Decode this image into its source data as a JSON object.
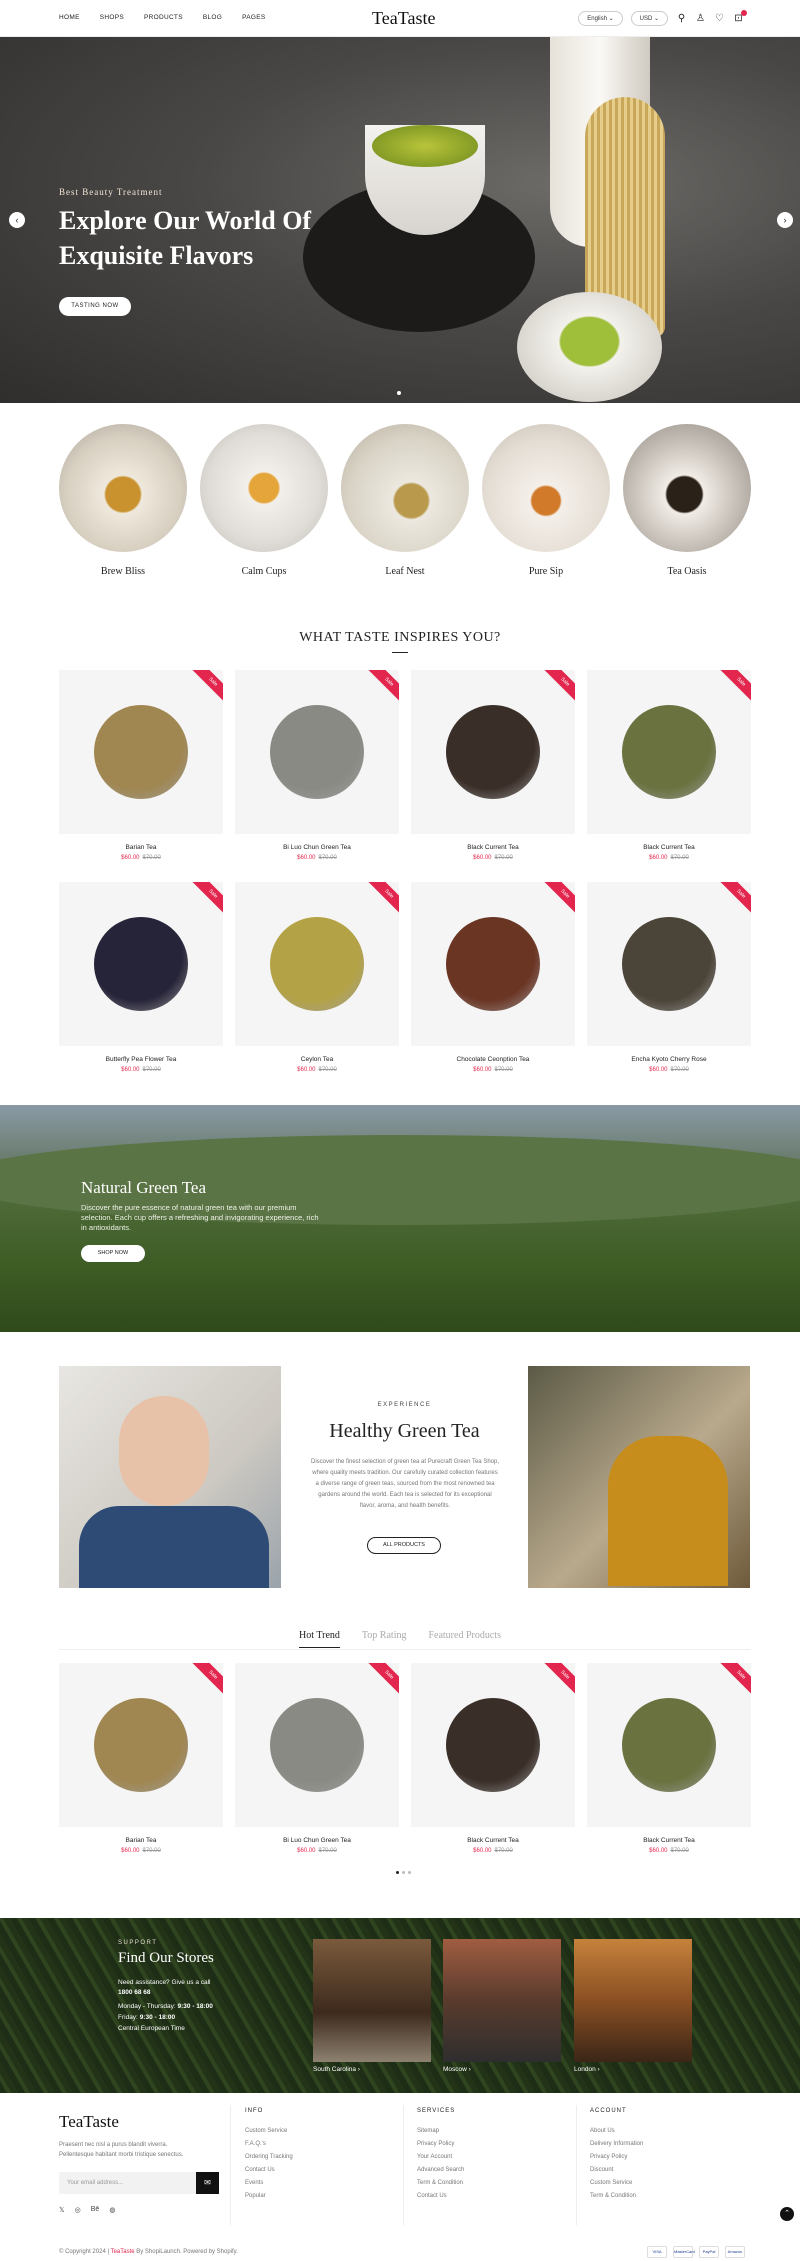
{
  "header": {
    "nav": [
      "HOME",
      "SHOPS",
      "PRODUCTS",
      "BLOG",
      "PAGES"
    ],
    "logo": "TeaTaste",
    "language": "English",
    "currency": "USD",
    "icons": [
      "search-icon",
      "user-icon",
      "heart-icon",
      "cart-icon"
    ]
  },
  "hero": {
    "subtitle": "Best Beauty Treatment",
    "title": "Explore Our World Of Exquisite Flavors",
    "button": "TASTING NOW",
    "prev": "‹",
    "next": "›"
  },
  "categories": [
    "Brew Bliss",
    "Calm Cups",
    "Leaf Nest",
    "Pure Sip",
    "Tea Oasis"
  ],
  "inspire": {
    "title": "WHAT TASTE INSPIRES YOU?"
  },
  "products": [
    {
      "name": "Barian Tea",
      "price": "$60.00",
      "old": "$70.00",
      "sale": "Sale",
      "color": "#a08650"
    },
    {
      "name": "Bi Luo Chun Green Tea",
      "price": "$60.00",
      "old": "$70.00",
      "sale": "Sale",
      "color": "#8a8a84"
    },
    {
      "name": "Black Current Tea",
      "price": "$60.00",
      "old": "$70.00",
      "sale": "Sale",
      "color": "#3a2e28"
    },
    {
      "name": "Black Current Tea",
      "price": "$60.00",
      "old": "$70.00",
      "sale": "Sale",
      "color": "#6a7240"
    },
    {
      "name": "Butterfly Pea Flower Tea",
      "price": "$60.00",
      "old": "$70.00",
      "sale": "Sale",
      "color": "#262438"
    },
    {
      "name": "Ceylon Tea",
      "price": "$60.00",
      "old": "$70.00",
      "sale": "Sale",
      "color": "#b4a246"
    },
    {
      "name": "Chocolate Ceonption Tea",
      "price": "$60.00",
      "old": "$70.00",
      "sale": "Sale",
      "color": "#6b3524"
    },
    {
      "name": "Encha Kyoto Cherry Rose",
      "price": "$60.00",
      "old": "$70.00",
      "sale": "Sale",
      "color": "#4b4438"
    }
  ],
  "banner": {
    "title": "Natural Green Tea",
    "text": "Discover the pure essence of natural green tea with our premium selection. Each cup offers a refreshing and invigorating experience, rich in antioxidants.",
    "button": "SHOP NOW"
  },
  "experience": {
    "kicker": "EXPERIENCE",
    "title": "Healthy Green Tea",
    "text": "Discover the finest selection of green tea at Purecraft Green Tea Shop, where quality meets tradition. Our carefully curated collection features a diverse range of green teas, sourced from the most renowned tea gardens around the world. Each tea is selected for its exceptional flavor, aroma, and health benefits.",
    "button": "ALL PRODUCTS"
  },
  "tabs": [
    {
      "label": "Hot Trend",
      "active": true
    },
    {
      "label": "Top Rating",
      "active": false
    },
    {
      "label": "Featured Products",
      "active": false
    }
  ],
  "stores": {
    "kicker": "SUPPORT",
    "title": "Find Our Stores",
    "line1": "Need assistance? Give us a call",
    "phone": "1800 68 68",
    "hours1_label": "Monday - Thursday:",
    "hours1": "9:30 - 18:00",
    "hours2_label": "Friday:",
    "hours2": "9:30 - 18:00",
    "tz": "Central European Time",
    "locations": [
      "South Carolina",
      "Moscow",
      "London"
    ]
  },
  "footer": {
    "logo": "TeaTaste",
    "about": "Praesent nec nisl a purus blandit viverra. Pellentesque habitant morbi tristique senectus.",
    "email_placeholder": "Your email address...",
    "social": [
      "twitter-icon",
      "instagram-icon",
      "behance-icon",
      "dribbble-icon"
    ],
    "cols": [
      {
        "title": "INFO",
        "items": [
          "Custom Service",
          "F.A.Q.'s",
          "Ordering Tracking",
          "Contact Us",
          "Events",
          "Popular"
        ]
      },
      {
        "title": "SERVICES",
        "items": [
          "Sitemap",
          "Privacy Policy",
          "Your Account",
          "Advanced Search",
          "Term & Condition",
          "Contact Us"
        ]
      },
      {
        "title": "ACCOUNT",
        "items": [
          "About Us",
          "Delivery Information",
          "Privacy Policy",
          "Discount",
          "Custom Service",
          "Term & Condition"
        ]
      }
    ],
    "copyright_prefix": "© Copyright 2024 |",
    "copyright_brand": "TeaTaste",
    "copyright_suffix": "By ShopiLaunch. Powered by Shopify.",
    "payments": [
      "VISA",
      "MasterCard",
      "PayPal",
      "Amazon"
    ]
  }
}
